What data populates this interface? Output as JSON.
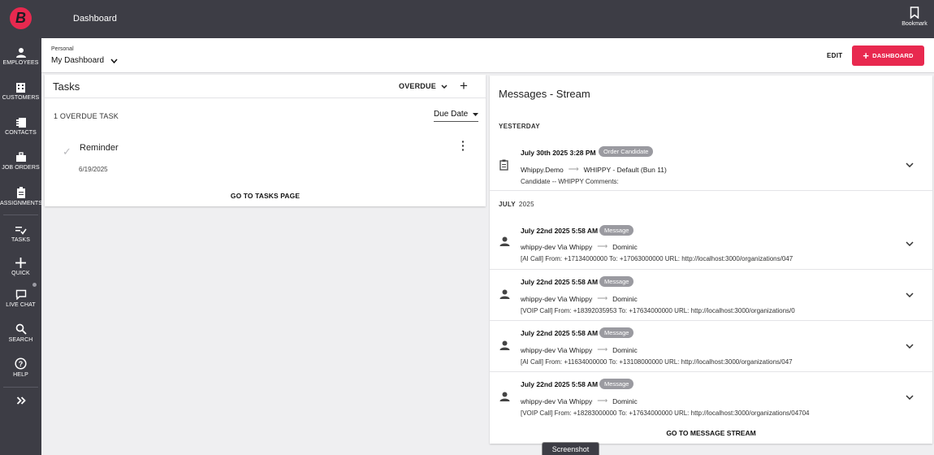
{
  "app": {
    "logo_letter": "B",
    "title": "Dashboard",
    "bookmark_label": "Bookmark",
    "brand_color": "#e8294f",
    "sidebar_color": "#3d3d45"
  },
  "sidebar": {
    "items": [
      {
        "label": "EMPLOYEES",
        "icon": "person-icon"
      },
      {
        "label": "CUSTOMERS",
        "icon": "building-icon"
      },
      {
        "label": "CONTACTS",
        "icon": "contacts-icon"
      },
      {
        "label": "JOB ORDERS",
        "icon": "briefcase-icon"
      },
      {
        "label": "ASSIGNMENTS",
        "icon": "clipboard-icon"
      },
      {
        "label": "TASKS",
        "icon": "checklist-icon"
      },
      {
        "label": "QUICK",
        "icon": "plus-icon"
      },
      {
        "label": "LIVE CHAT",
        "icon": "chat-icon"
      },
      {
        "label": "SEARCH",
        "icon": "search-icon"
      },
      {
        "label": "HELP",
        "icon": "help-icon"
      }
    ],
    "expand_icon": "double-chevron-right-icon"
  },
  "dashboard": {
    "category": "Personal",
    "selected": "My Dashboard",
    "edit_label": "EDIT",
    "add_label": "DASHBOARD"
  },
  "tasks": {
    "title": "Tasks",
    "filter": "OVERDUE",
    "count_label": "1 OVERDUE TASK",
    "sort_label": "Due Date",
    "items": [
      {
        "name": "Reminder",
        "date": "6/19/2025"
      }
    ],
    "footer_link": "GO TO TASKS PAGE"
  },
  "messages": {
    "title": "Messages - Stream",
    "sections": [
      {
        "label": "YESTERDAY",
        "sublabel": ""
      },
      {
        "label": "JULY",
        "sublabel": "2025"
      }
    ],
    "items": [
      {
        "date": "July 30th 2025 3:28 PM",
        "badge": "Order Candidate",
        "from": "Whippy.Demo",
        "to": "WHIPPY - Default (Bun 11)",
        "body": "Candidate -- WHIPPY Comments:",
        "icon": "clipboard-icon"
      },
      {
        "date": "July 22nd 2025 5:58 AM",
        "badge": "Message",
        "from": "whippy-dev Via Whippy",
        "to": "Dominic",
        "body": "[AI Call] From: +17134000000 To: +17063000000 URL: http://localhost:3000/organizations/047",
        "icon": "person-icon"
      },
      {
        "date": "July 22nd 2025 5:58 AM",
        "badge": "Message",
        "from": "whippy-dev Via Whippy",
        "to": "Dominic",
        "body": "[VOIP Call] From: +18392035953 To: +17634000000 URL: http://localhost:3000/organizations/0",
        "icon": "person-icon"
      },
      {
        "date": "July 22nd 2025 5:58 AM",
        "badge": "Message",
        "from": "whippy-dev Via Whippy",
        "to": "Dominic",
        "body": "[AI Call] From: +11634000000 To: +13108000000 URL: http://localhost:3000/organizations/047",
        "icon": "person-icon"
      },
      {
        "date": "July 22nd 2025 5:58 AM",
        "badge": "Message",
        "from": "whippy-dev Via Whippy",
        "to": "Dominic",
        "body": "[VOIP Call] From: +18283000000 To: +17634000000 URL: http://localhost:3000/organizations/04704",
        "icon": "person-icon"
      }
    ],
    "footer_link": "GO TO MESSAGE STREAM"
  },
  "overlay": {
    "screenshot_tab": "Screenshot"
  }
}
